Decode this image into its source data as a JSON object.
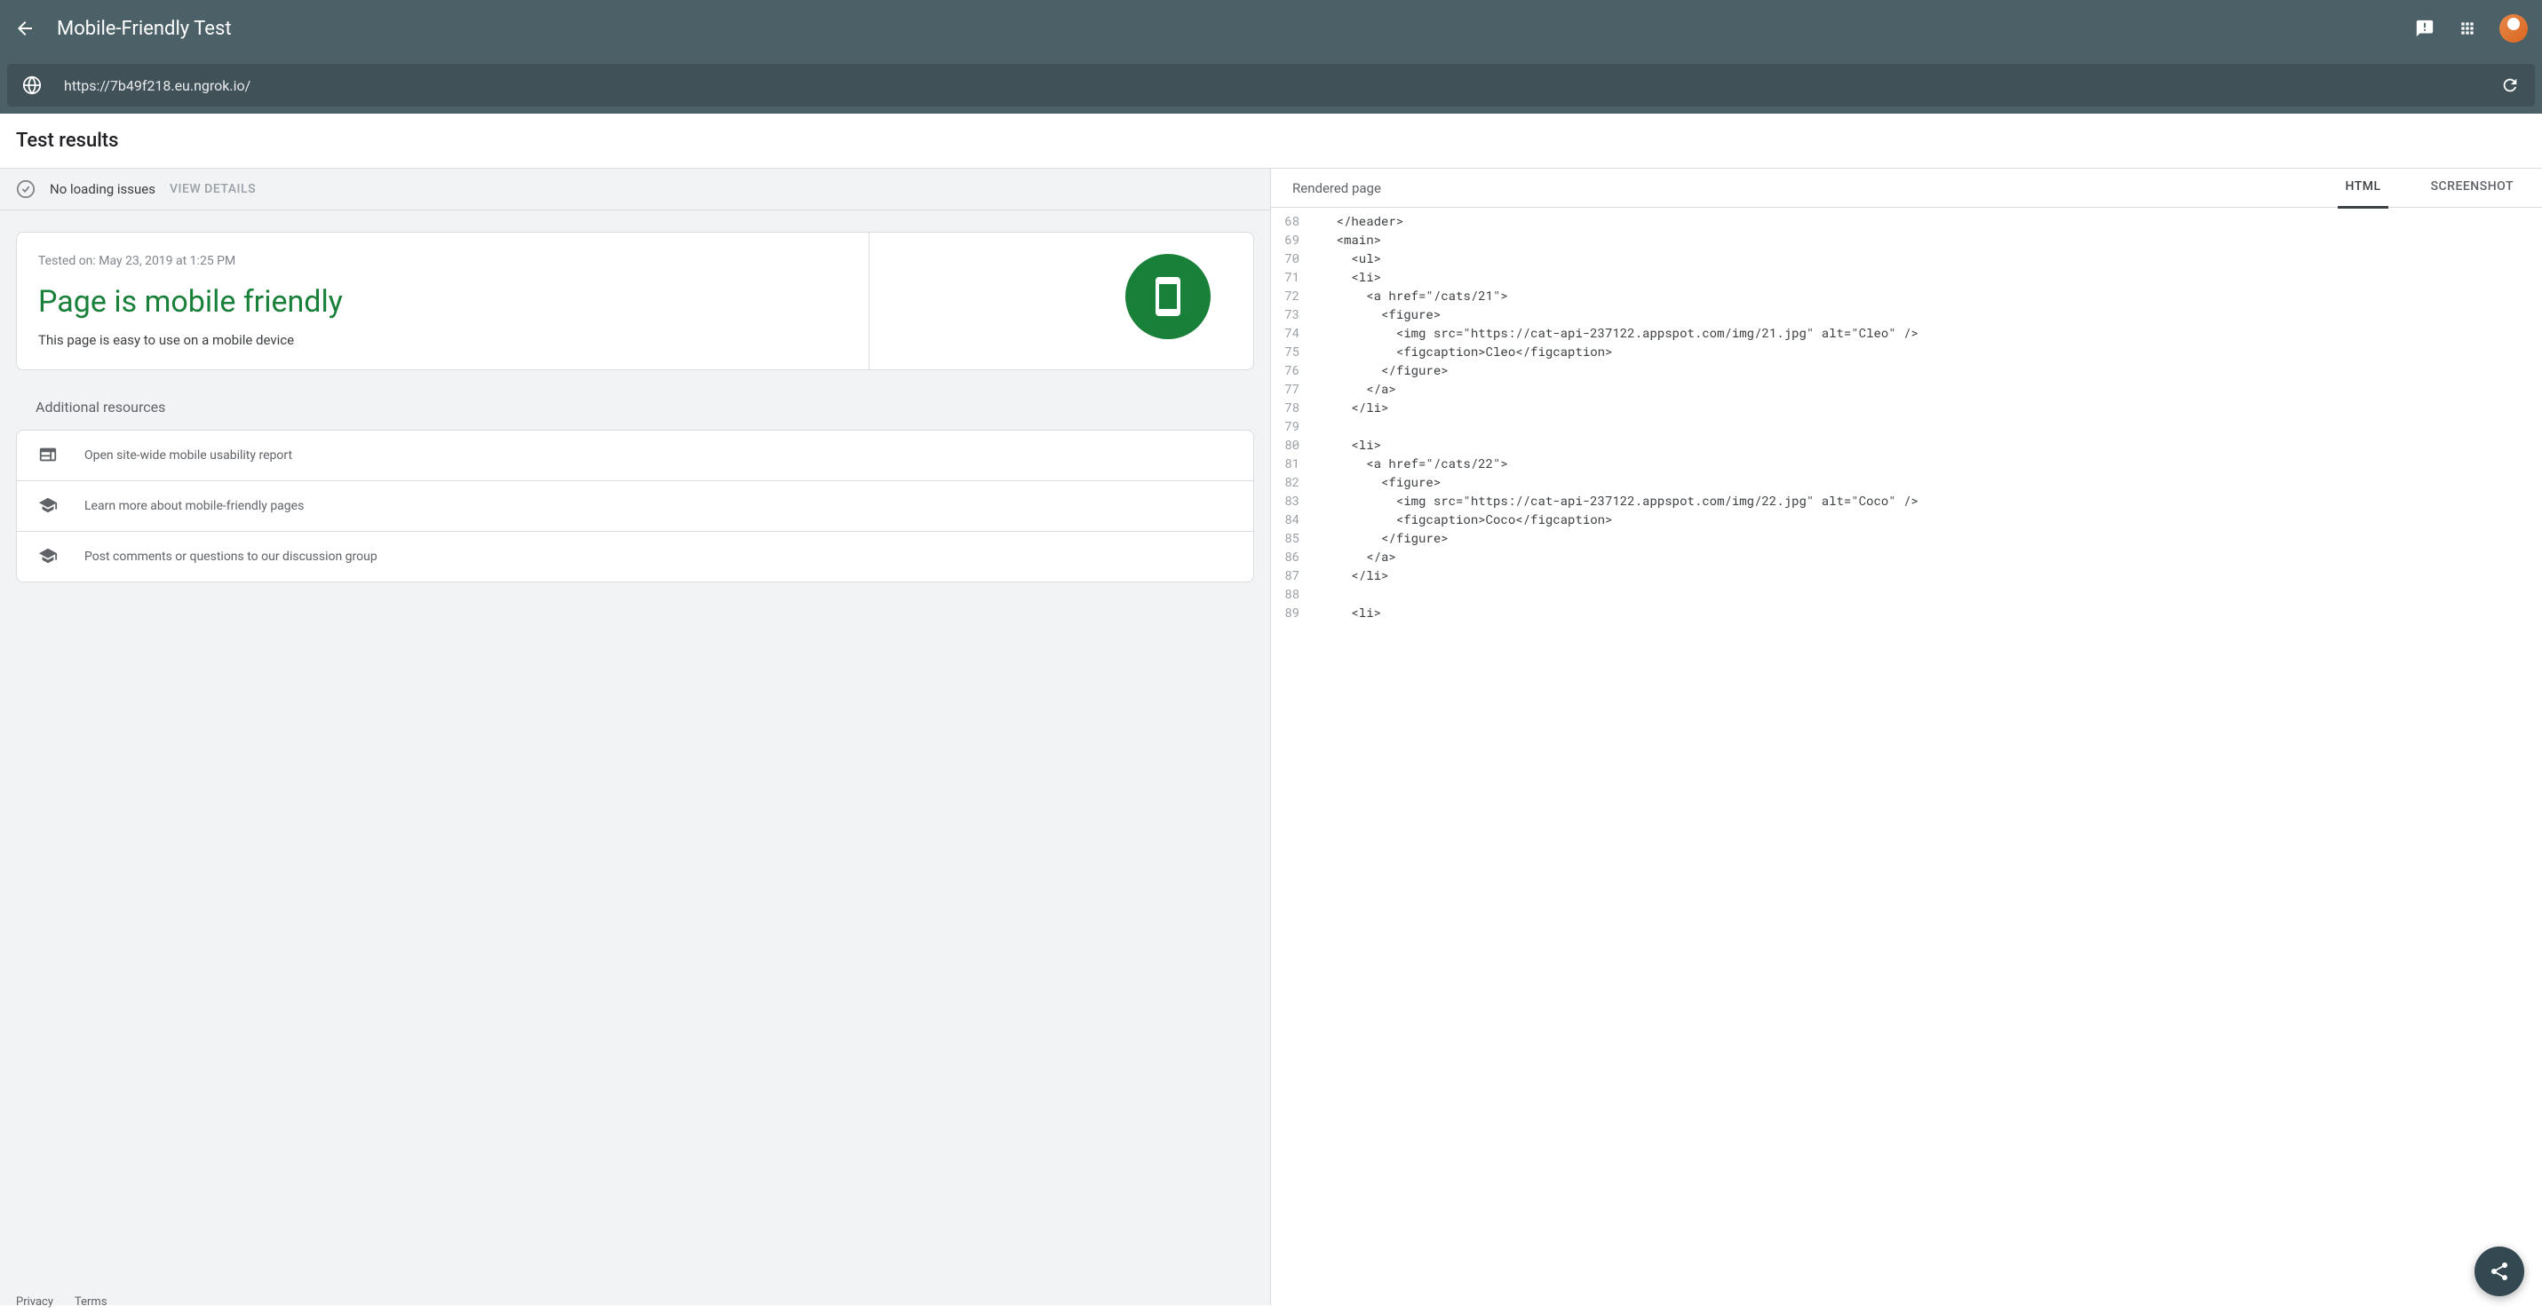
{
  "header": {
    "title": "Mobile-Friendly Test"
  },
  "url_bar": {
    "url": "https://7b49f218.eu.ngrok.io/"
  },
  "section": {
    "title": "Test results"
  },
  "loading": {
    "text": "No loading issues",
    "details_label": "VIEW DETAILS"
  },
  "result": {
    "tested_on": "Tested on: May 23, 2019 at 1:25 PM",
    "title": "Page is mobile friendly",
    "description": "This page is easy to use on a mobile device"
  },
  "resources": {
    "title": "Additional resources",
    "items": [
      "Open site-wide mobile usability report",
      "Learn more about mobile-friendly pages",
      "Post comments or questions to our discussion group"
    ]
  },
  "right_panel": {
    "label": "Rendered page",
    "tabs": {
      "html": "HTML",
      "screenshot": "SCREENSHOT"
    }
  },
  "code": {
    "lines": [
      {
        "num": "68",
        "text": "    </header>"
      },
      {
        "num": "69",
        "text": "    <main>"
      },
      {
        "num": "70",
        "text": "      <ul>"
      },
      {
        "num": "71",
        "text": "      <li>"
      },
      {
        "num": "72",
        "text": "        <a href=\"/cats/21\">"
      },
      {
        "num": "73",
        "text": "          <figure>"
      },
      {
        "num": "74",
        "text": "            <img src=\"https://cat-api-237122.appspot.com/img/21.jpg\" alt=\"Cleo\" />"
      },
      {
        "num": "75",
        "text": "            <figcaption>Cleo</figcaption>"
      },
      {
        "num": "76",
        "text": "          </figure>"
      },
      {
        "num": "77",
        "text": "        </a>"
      },
      {
        "num": "78",
        "text": "      </li>"
      },
      {
        "num": "79",
        "text": ""
      },
      {
        "num": "80",
        "text": "      <li>"
      },
      {
        "num": "81",
        "text": "        <a href=\"/cats/22\">"
      },
      {
        "num": "82",
        "text": "          <figure>"
      },
      {
        "num": "83",
        "text": "            <img src=\"https://cat-api-237122.appspot.com/img/22.jpg\" alt=\"Coco\" />"
      },
      {
        "num": "84",
        "text": "            <figcaption>Coco</figcaption>"
      },
      {
        "num": "85",
        "text": "          </figure>"
      },
      {
        "num": "86",
        "text": "        </a>"
      },
      {
        "num": "87",
        "text": "      </li>"
      },
      {
        "num": "88",
        "text": ""
      },
      {
        "num": "89",
        "text": "      <li>"
      }
    ]
  },
  "footer": {
    "privacy": "Privacy",
    "terms": "Terms"
  }
}
